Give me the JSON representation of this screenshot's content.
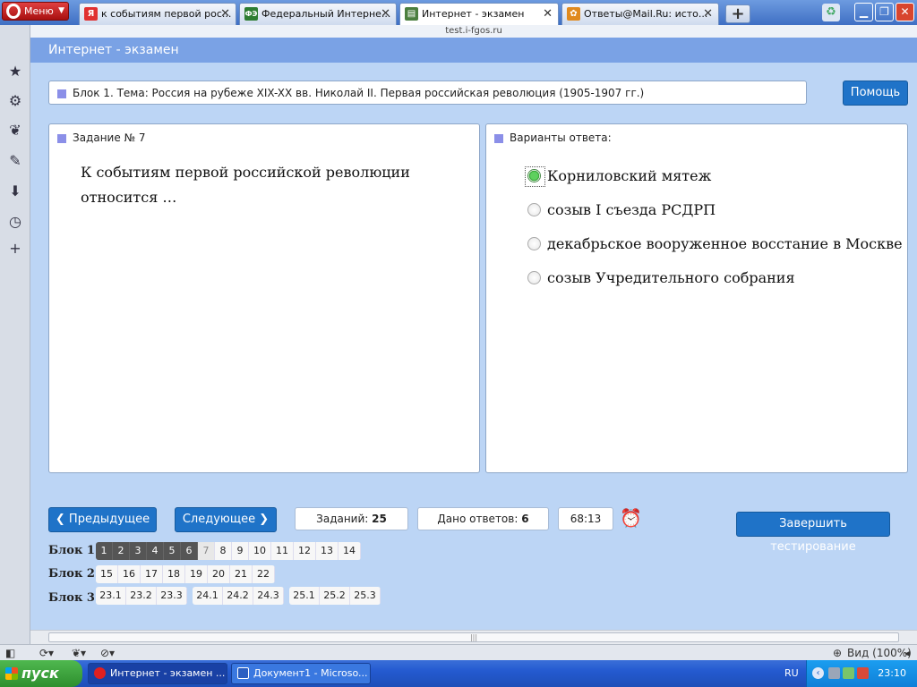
{
  "browser": {
    "menu_label": "Меню",
    "tabs": [
      {
        "title": "к событиям первой рос...",
        "favicon": "Я",
        "favicon_color": "#e03030"
      },
      {
        "title": "Федеральный Интерне...",
        "favicon": "ФЭ",
        "favicon_color": "#2e7d32"
      },
      {
        "title": "Интернет - экзамен",
        "favicon": "▤",
        "favicon_color": "#4b7f3f"
      },
      {
        "title": "Ответы@Mail.Ru: исто...",
        "favicon": "✿",
        "favicon_color": "#e08a1e"
      }
    ],
    "active_tab": 2,
    "address": "test.i-fgos.ru",
    "zoom_label": "Вид (100%)"
  },
  "page": {
    "header_title": "Интернет - экзамен",
    "topic": "Блок 1. Тема: Россия на рубеже XIX-XX вв. Николай II. Первая российская революция (1905-1907 гг.)",
    "help_label": "Помощь",
    "task_label": "Задание № 7",
    "question_text": "К событиям первой российской революции относится …",
    "answers_label": "Варианты ответа:",
    "answers": [
      {
        "text": "Корниловский мятеж",
        "checked": true
      },
      {
        "text": "созыв I съезда РСДРП",
        "checked": false
      },
      {
        "text": "декабрьское вооруженное восстание в Москве",
        "checked": false
      },
      {
        "text": "созыв Учредительного собрания",
        "checked": false
      }
    ],
    "prev_label": "Предыдущее",
    "next_label": "Следующее",
    "total_tasks_label": "Заданий:",
    "total_tasks_value": "25",
    "answered_label": "Дано ответов:",
    "answered_value": "6",
    "timer": "68:13",
    "finish_label": "Завершить тестирование"
  },
  "blocks": [
    {
      "label": "Блок 1",
      "groups": [
        [
          "1",
          "2",
          "3",
          "4",
          "5",
          "6",
          "7",
          "8",
          "9",
          "10",
          "11",
          "12",
          "13",
          "14"
        ]
      ]
    },
    {
      "label": "Блок 2",
      "groups": [
        [
          "15",
          "16",
          "17",
          "18",
          "19",
          "20",
          "21",
          "22"
        ]
      ]
    },
    {
      "label": "Блок 3",
      "groups": [
        [
          "23.1",
          "23.2",
          "23.3"
        ],
        [
          "24.1",
          "24.2",
          "24.3"
        ],
        [
          "25.1",
          "25.2",
          "25.3"
        ]
      ]
    }
  ],
  "done_items": [
    "1",
    "2",
    "3",
    "4",
    "5",
    "6"
  ],
  "current_item": "7",
  "taskbar": {
    "start_label": "пуск",
    "tasks": [
      {
        "label": "Интернет - экзамен ...",
        "color": "#e02020"
      },
      {
        "label": "Документ1 - Microso...",
        "color": "#2b5fc2"
      }
    ],
    "lang": "RU",
    "clock": "23:10"
  }
}
